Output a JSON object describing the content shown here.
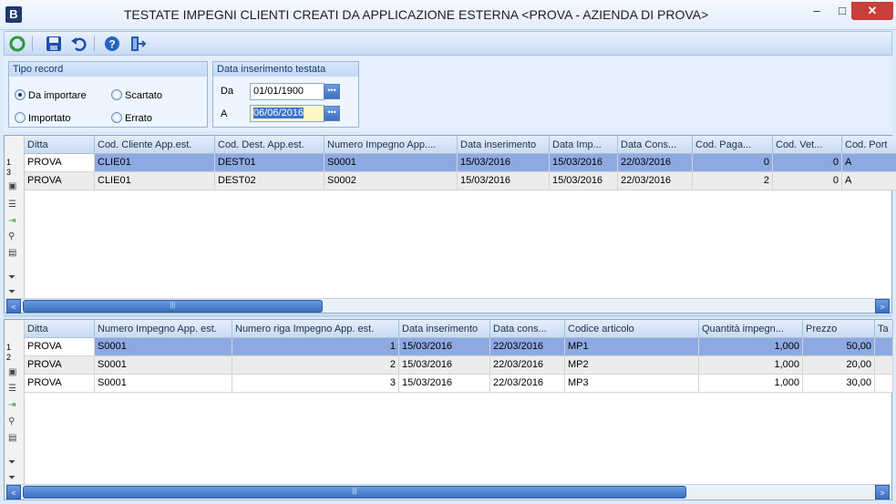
{
  "window": {
    "app_letter": "B",
    "title": "TESTATE IMPEGNI CLIENTI CREATI DA APPLICAZIONE ESTERNA <PROVA - AZIENDA DI PROVA>",
    "min": "–",
    "max": "□",
    "close": "✕"
  },
  "toolbar": {
    "icons": [
      "refresh-icon",
      "save-icon",
      "undo-icon",
      "help-icon",
      "exit-icon"
    ]
  },
  "tipo_record": {
    "title": "Tipo record",
    "options": [
      "Da importare",
      "Scartato",
      "Importato",
      "Errato"
    ],
    "selected": "Da importare"
  },
  "data_inserimento": {
    "title": "Data inserimento testata",
    "da_label": "Da",
    "da_value": "01/01/1900",
    "a_label": "A",
    "a_value": "06/06/2016",
    "button": "•••"
  },
  "top_grid": {
    "columns": [
      "Ditta",
      "Cod. Cliente App.est.",
      "Cod. Dest. App.est.",
      "Numero Impegno App....",
      "Data inserimento",
      "Data Imp...",
      "Data Cons...",
      "Cod. Paga...",
      "Cod. Vet...",
      "Cod. Port"
    ],
    "rows": [
      [
        "PROVA",
        "CLIE01",
        "DEST01",
        "S0001",
        "15/03/2016",
        "15/03/2016",
        "22/03/2016",
        "0",
        "0",
        "A"
      ],
      [
        "PROVA",
        "CLIE01",
        "DEST02",
        "S0002",
        "15/03/2016",
        "15/03/2016",
        "22/03/2016",
        "2",
        "0",
        "A"
      ]
    ],
    "row_indicator": [
      "1",
      "3"
    ]
  },
  "bottom_grid": {
    "columns": [
      "Ditta",
      "Numero Impegno App. est.",
      "Numero riga Impegno App. est.",
      "Data inserimento",
      "Data cons...",
      "Codice articolo",
      "Quantità impegn...",
      "Prezzo",
      "Ta"
    ],
    "rows": [
      [
        "PROVA",
        "S0001",
        "1",
        "15/03/2016",
        "22/03/2016",
        "MP1",
        "1,000",
        "50,00",
        ""
      ],
      [
        "PROVA",
        "S0001",
        "2",
        "15/03/2016",
        "22/03/2016",
        "MP2",
        "1,000",
        "20,00",
        ""
      ],
      [
        "PROVA",
        "S0001",
        "3",
        "15/03/2016",
        "22/03/2016",
        "MP3",
        "1,000",
        "30,00",
        ""
      ]
    ],
    "row_indicator": [
      "1",
      "2"
    ]
  },
  "scroll": {
    "left": "<",
    "right": ">",
    "grip": "|||"
  },
  "colors": {
    "selected_row": "#8ea9e2",
    "selected_cell": "#ffffff",
    "alt_row": "#ececec"
  }
}
